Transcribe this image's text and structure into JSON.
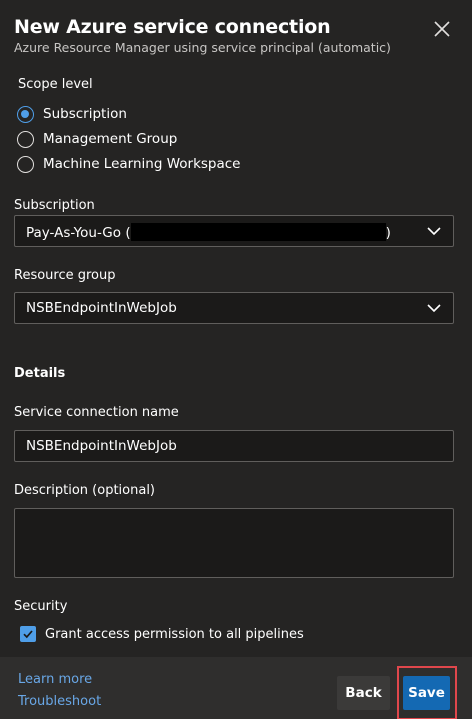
{
  "header": {
    "title": "New Azure service connection",
    "subtitle": "Azure Resource Manager using service principal (automatic)"
  },
  "scope": {
    "label": "Scope level",
    "options": [
      {
        "label": "Subscription",
        "checked": true
      },
      {
        "label": "Management Group",
        "checked": false
      },
      {
        "label": "Machine Learning Workspace",
        "checked": false
      }
    ]
  },
  "subscription": {
    "label": "Subscription",
    "value_prefix": "Pay-As-You-Go (",
    "value_suffix": ")"
  },
  "resource_group": {
    "label": "Resource group",
    "value": "NSBEndpointInWebJob"
  },
  "details": {
    "title": "Details",
    "name_label": "Service connection name",
    "name_value": "NSBEndpointInWebJob",
    "description_label": "Description (optional)",
    "description_value": ""
  },
  "security": {
    "label": "Security",
    "grant_label": "Grant access permission to all pipelines",
    "grant_checked": true
  },
  "footer": {
    "learn_more": "Learn more",
    "troubleshoot": "Troubleshoot",
    "back_label": "Back",
    "save_label": "Save"
  },
  "colors": {
    "accent": "#4f9ee8",
    "primary_button": "#1469b3",
    "highlight": "#e0474c"
  },
  "icons": {
    "close": "close-icon",
    "dropdown": "chevron-down-icon",
    "check": "checkmark-icon"
  }
}
